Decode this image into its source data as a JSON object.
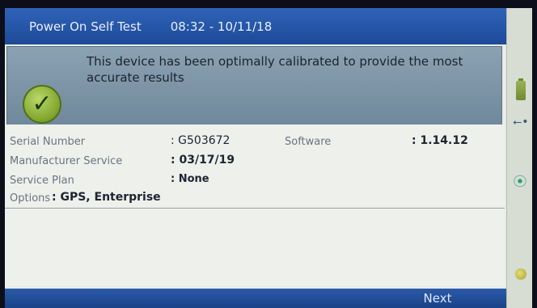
{
  "titlebar": {
    "title": "Power On Self Test",
    "datetime": "08:32 - 10/11/18"
  },
  "banner": {
    "message": "This device has been optimally calibrated to provide the most accurate results",
    "icon": "checkmark-icon"
  },
  "info": {
    "serial_label": "Serial Number",
    "serial_value": ": G503672",
    "software_label": "Software",
    "software_value": ": 1.14.12",
    "manufacturer_label": "Manufacturer Service",
    "manufacturer_value": ": 03/17/19",
    "plan_label": "Service Plan",
    "plan_value": ": None",
    "options_label": "Options",
    "options_value": ": GPS, Enterprise"
  },
  "bottombar": {
    "next_label": "Next"
  },
  "statusbar": {
    "icons": [
      "battery-icon",
      "usb-icon",
      "wifi-icon",
      "location-icon"
    ]
  }
}
